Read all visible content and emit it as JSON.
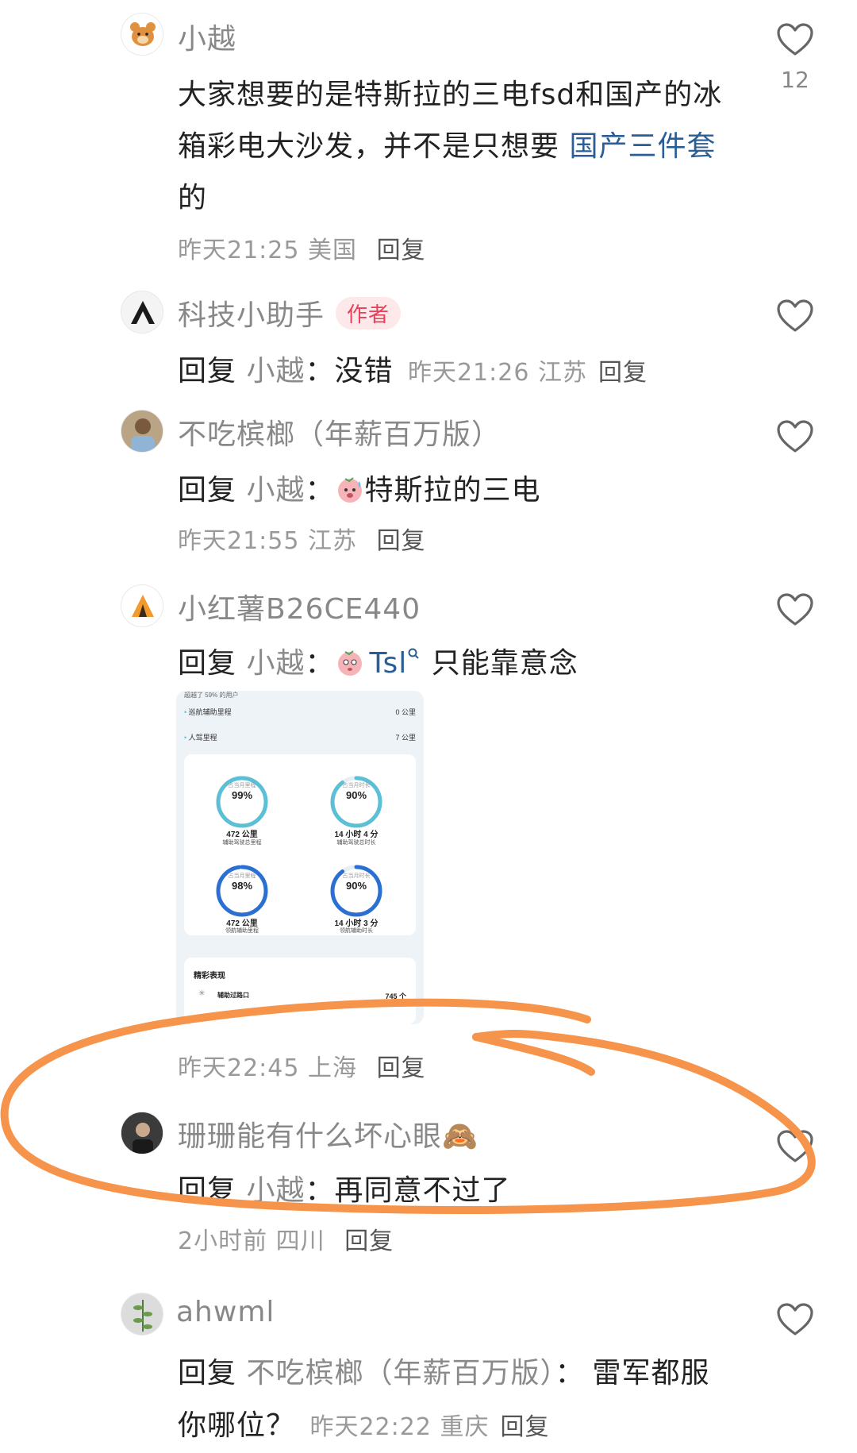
{
  "comments": [
    {
      "name": "小越",
      "text_line1": "大家想要的是特斯拉的三电fsd和国产的冰",
      "text_line2_a": "箱彩电大沙发，并不是只想要 ",
      "text_line2_link": "国产三件套",
      "text_line3": "的",
      "time": "昨天21:25",
      "location": "美国",
      "reply": "回复",
      "likes": "12"
    },
    {
      "name": "科技小助手",
      "badge": "作者",
      "reply_word": "回复",
      "reply_target": "小越",
      "colon": "：",
      "text": "没错",
      "time": "昨天21:26",
      "location": "江苏",
      "reply": "回复"
    },
    {
      "name": "不吃槟榔（年薪百万版）",
      "reply_word": "回复",
      "reply_target": "小越",
      "colon": "：",
      "text": "特斯拉的三电",
      "time": "昨天21:55",
      "location": "江苏",
      "reply": "回复"
    },
    {
      "name": "小红薯B26CE440",
      "reply_word": "回复",
      "reply_target": "小越",
      "colon": "：",
      "link_text": "Tsl",
      "text": " 只能靠意念",
      "time": "昨天22:45",
      "location": "上海",
      "reply": "回复",
      "image": {
        "top_text": "超越了 59% 的用户",
        "row1_label": "巡航辅助里程",
        "row1_value": "0 公里",
        "row2_label": "人驾里程",
        "row2_value": "7 公里",
        "rings": [
          {
            "top": "占当月里程",
            "value": "99%",
            "sub1": "472 公里",
            "sub2": "辅助驾驶总里程",
            "fraction": 0.99,
            "color": "#5bbfd6"
          },
          {
            "top": "占当月时长",
            "value": "90%",
            "sub1": "14 小时 4 分",
            "sub2": "辅助驾驶总时长",
            "fraction": 0.9,
            "color": "#5bbfd6"
          },
          {
            "top": "占当月里程",
            "value": "98%",
            "sub1": "472 公里",
            "sub2": "领航辅助里程",
            "fraction": 0.98,
            "color": "#2a6fd1"
          },
          {
            "top": "占当月时长",
            "value": "90%",
            "sub1": "14 小时 3 分",
            "sub2": "领航辅助时长",
            "fraction": 0.9,
            "color": "#2a6fd1"
          }
        ],
        "section_title": "精彩表现",
        "section_row_label": "辅助过路口",
        "section_row_value": "745 个"
      }
    },
    {
      "name": "珊珊能有什么坏心眼🙈",
      "reply_word": "回复",
      "reply_target": "小越",
      "colon": "：",
      "text": "再同意不过了",
      "time": "2小时前",
      "location": "四川",
      "reply": "回复"
    },
    {
      "name": "ahwml",
      "reply_word": "回复",
      "reply_target": "不吃槟榔（年薪百万版）",
      "colon": "：",
      "text_line1": "雷军都服",
      "text_line2": "你哪位？",
      "time": "昨天22:22",
      "location": "重庆",
      "reply": "回复"
    }
  ],
  "colors": {
    "annotation": "#f5944a",
    "link": "#2b5e96",
    "author_badge_bg": "#fde8ea",
    "author_badge_text": "#e8405a"
  }
}
